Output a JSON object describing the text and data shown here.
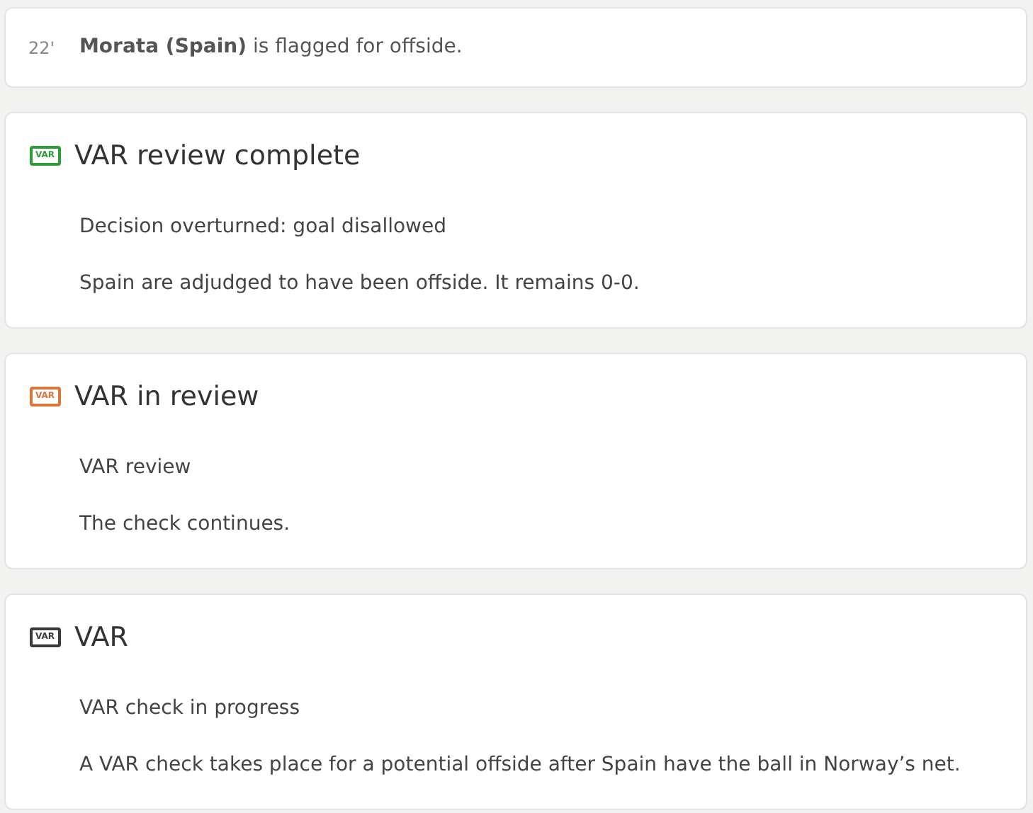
{
  "event": {
    "minute": "22'",
    "text": "**Morata (Spain)** is flagged for offside."
  },
  "cards": [
    {
      "badge": "VAR",
      "color": "#2e9b3a",
      "title": "VAR review complete",
      "lines": [
        "Decision overturned: goal disallowed",
        "Spain are adjudged to have been offside. It remains 0-0."
      ]
    },
    {
      "badge": "VAR",
      "color": "#d9763a",
      "title": "VAR in review",
      "lines": [
        "VAR review",
        "The check continues."
      ]
    },
    {
      "badge": "VAR",
      "color": "#3a3a3a",
      "title": "VAR",
      "lines": [
        "VAR check in progress",
        "A VAR check takes place for a potential offside after Spain have the ball in Norway’s net."
      ]
    }
  ]
}
